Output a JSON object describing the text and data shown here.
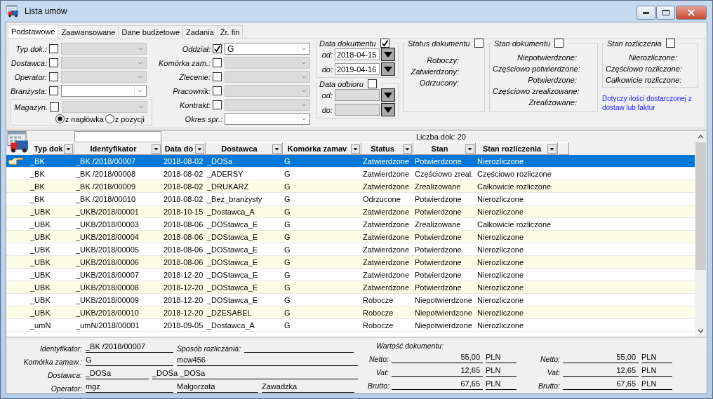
{
  "window": {
    "title": "Lista umów"
  },
  "tabs": [
    {
      "label": "Podstawowe",
      "selected": true
    },
    {
      "label": "Zaawansowane",
      "selected": false
    },
    {
      "label": "Dane budżetowe",
      "selected": false
    },
    {
      "label": "Zadania",
      "selected": false
    },
    {
      "label": "Źr. fin",
      "selected": false
    }
  ],
  "filters_left": [
    {
      "kind": "check_combo",
      "label": "Typ dok.:",
      "checked": false,
      "disabled": true
    },
    {
      "kind": "check_combo",
      "label": "Dostawca:",
      "checked": false,
      "disabled": true
    },
    {
      "kind": "check_combo",
      "label": "Operator:",
      "checked": false,
      "disabled": true
    },
    {
      "kind": "check_combo",
      "label": "Branżysta:",
      "checked": false,
      "disabled": false
    }
  ],
  "magazyn": {
    "label": "Magazyn.",
    "checked": false,
    "disabled": true,
    "options": [
      {
        "label": "z nagłówka",
        "selected": true
      },
      {
        "label": "z pozycji",
        "selected": false
      }
    ]
  },
  "filters_middle": [
    {
      "kind": "check_combo",
      "label": "Oddział:",
      "checked": true,
      "disabled": false,
      "value": "G"
    },
    {
      "kind": "check_combo",
      "label": "Komórka zam.:",
      "checked": false,
      "disabled": true
    },
    {
      "kind": "check_combo",
      "label": "Zlecenie:",
      "checked": false,
      "disabled": true
    },
    {
      "kind": "check_combo",
      "label": "Pracownik:",
      "checked": false,
      "disabled": true
    },
    {
      "kind": "check_combo",
      "label": "Kontrakt:",
      "checked": false,
      "disabled": true
    },
    {
      "kind": "combo",
      "label": "Okres spr.:",
      "disabled": false
    }
  ],
  "date_groups": [
    {
      "title": "Data dokumentu",
      "checked": true,
      "fields": [
        {
          "label": "od:",
          "value": "2018-04-15",
          "disabled": false
        },
        {
          "label": "do:",
          "value": "2019-04-16",
          "disabled": false
        }
      ]
    },
    {
      "title": "Data odbioru",
      "checked": false,
      "fields": [
        {
          "label": "od:",
          "disabled": true
        },
        {
          "label": "do:",
          "disabled": true
        }
      ]
    }
  ],
  "check_groups": [
    {
      "title": "Status dokumentu",
      "checked": false,
      "items": [
        "Roboczy:",
        "Zatwierdzony:",
        "Odrzucony:"
      ]
    },
    {
      "title": "Stan dokumentu",
      "checked": false,
      "items": [
        "Niepotwierdzone:",
        "Częściowo potwierdzone:",
        "Potwierdzone:",
        "Częściowo zrealizowane:",
        "Zrealizowane:"
      ]
    },
    {
      "title": "Stan rozliczenia",
      "checked": false,
      "items": [
        "Nierozliczone:",
        "Częściowo rozliczone:",
        "Całkowicie rozliczone:"
      ]
    }
  ],
  "note": "Dotyczy  ilości dostarczonej z dostaw lub faktur",
  "grid": {
    "count_label": "Liczba dok: 20",
    "columns": [
      "Typ dok",
      "Identyfikator",
      "Data do",
      "Dostawca",
      "Komórka zamav",
      "Status",
      "Stan",
      "Stan rozliczenia"
    ],
    "rows": [
      {
        "selected": true,
        "cells": [
          "_BK",
          "_BK /2018/00007",
          "2018-08-02",
          "_DOSa",
          "G",
          "Zatwierdzone",
          "Potwierdzone",
          "Nierozliczone"
        ]
      },
      {
        "selected": false,
        "cells": [
          "_BK",
          "_BK /2018/00008",
          "2018-08-02",
          "_ADERSY",
          "G",
          "Zatwierdzone",
          "Częściowo zreal.",
          "Częściowo rozliczone"
        ]
      },
      {
        "selected": false,
        "cells": [
          "_BK",
          "_BK /2018/00009",
          "2018-08-02",
          "_DRUKARZ",
          "G",
          "Zatwierdzone",
          "Zrealizowane",
          "Całkowicie rozliczone"
        ]
      },
      {
        "selected": false,
        "cells": [
          "_BK",
          "_BK /2018/00010",
          "2018-08-02",
          "_Bez_branżysty",
          "G",
          "Odrzucone",
          "Potwierdzone",
          "Nierozliczone"
        ]
      },
      {
        "selected": false,
        "cells": [
          "_UBK",
          "_UKB/2018/00001",
          "2018-10-15",
          "_Dostawca_A",
          "G",
          "Zatwierdzone",
          "Potwierdzone",
          "Nierozliczone"
        ]
      },
      {
        "selected": false,
        "cells": [
          "_UBK",
          "_UKB/2018/00003",
          "2018-08-06",
          "_DOStawca_E",
          "G",
          "Zatwierdzone",
          "Zrealizowane",
          "Całkowicie rozliczone"
        ]
      },
      {
        "selected": false,
        "cells": [
          "_UBK",
          "_UKB/2018/00004",
          "2018-08-06",
          "_DOStawca_E",
          "G",
          "Zatwierdzone",
          "Potwierdzone",
          "Nierozliczone"
        ]
      },
      {
        "selected": false,
        "cells": [
          "_UBK",
          "_UKB/2018/00005",
          "2018-08-06",
          "_DOStawca_E",
          "G",
          "Zatwierdzone",
          "Potwierdzone",
          "Nierozliczone"
        ]
      },
      {
        "selected": false,
        "cells": [
          "_UBK",
          "_UKB/2018/00006",
          "2018-08-06",
          "_DOStawca_E",
          "G",
          "Zatwierdzone",
          "Potwierdzone",
          "Nierozliczone"
        ]
      },
      {
        "selected": false,
        "cells": [
          "_UBK",
          "_UKB/2018/00007",
          "2018-12-20",
          "_DOStawca_E",
          "G",
          "Zatwierdzone",
          "Potwierdzone",
          "Nierozliczone"
        ]
      },
      {
        "selected": false,
        "cells": [
          "_UBK",
          "_UKB/2018/00008",
          "2018-12-20",
          "_DOStawca_E",
          "G",
          "Zatwierdzone",
          "Potwierdzone",
          "Nierozliczone"
        ]
      },
      {
        "selected": false,
        "cells": [
          "_UBK",
          "_UKB/2018/00009",
          "2018-12-20",
          "_DOStawca_E",
          "G",
          "Robocze",
          "Niepotwierdzone",
          "Nierozliczone"
        ]
      },
      {
        "selected": false,
        "cells": [
          "_UBK",
          "_UKB/2018/00010",
          "2018-12-20",
          "_DŻESABEL",
          "G",
          "Robocze",
          "Niepotwierdzone",
          "Nierozliczone"
        ]
      },
      {
        "selected": false,
        "cells": [
          "_umN",
          "_umN/2018/00001",
          "2018-09-05",
          "_Dostawca_A",
          "G",
          "Robocze",
          "Niepotwierdzone",
          "Nierozliczone"
        ]
      }
    ]
  },
  "details": [
    [
      {
        "kind": "label",
        "text": "Identyfikator:"
      },
      {
        "kind": "value",
        "text": "_BK /2018/00007"
      },
      {
        "kind": "label",
        "text": "Sposób rozliczania:"
      },
      {
        "kind": "value"
      }
    ],
    [
      {
        "kind": "label",
        "text": "Komórka zamaw.:"
      },
      {
        "kind": "value",
        "text": "G"
      },
      {
        "kind": "value",
        "text": "mcw456"
      }
    ],
    [
      {
        "kind": "label",
        "text": "Dostawca:"
      },
      {
        "kind": "value",
        "text": "_DOSa"
      },
      {
        "kind": "value",
        "text": "_DOSa _DOSa"
      }
    ],
    [
      {
        "kind": "label",
        "text": "Operator:"
      },
      {
        "kind": "value",
        "text": "mgz"
      },
      {
        "kind": "value",
        "text": "Małgorzata"
      },
      {
        "kind": "value",
        "text": "Zawadzka"
      }
    ]
  ],
  "totals": {
    "title": "Wartość dokumentu:",
    "columns": [
      [
        {
          "label": "Netto:",
          "amount": "55,00",
          "currency": "PLN"
        },
        {
          "label": "Vat:",
          "amount": "12,65",
          "currency": "PLN"
        },
        {
          "label": "Brutto:",
          "amount": "67,65",
          "currency": "PLN"
        }
      ],
      [
        {
          "label": "Netto:",
          "amount": "55,00",
          "currency": "PLN"
        },
        {
          "label": "Vat:",
          "amount": "12,65",
          "currency": "PLN"
        },
        {
          "label": "Brutto:",
          "amount": "67,65",
          "currency": "PLN"
        }
      ]
    ]
  }
}
